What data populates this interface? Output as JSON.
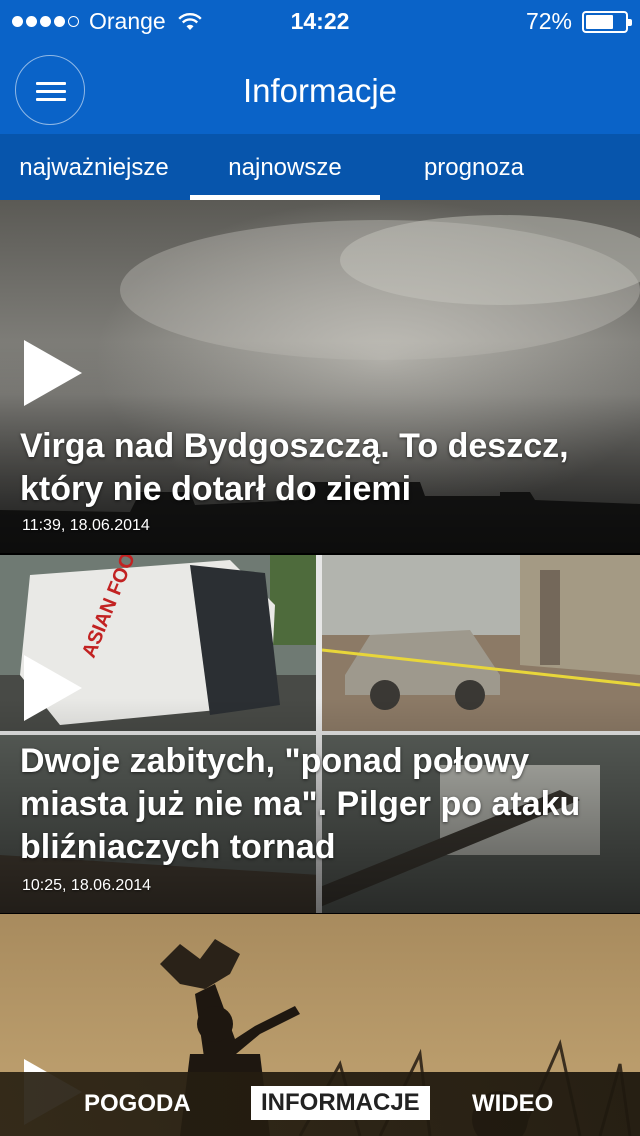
{
  "status_bar": {
    "carrier": "Orange",
    "time": "14:22",
    "battery": "72%",
    "battery_level": 0.72,
    "signal_bars": 4,
    "signal_max": 5
  },
  "header": {
    "title": "Informacje",
    "color": "#0a63c8"
  },
  "tabs": [
    {
      "label": "najważniejsze",
      "active": false
    },
    {
      "label": "najnowsze",
      "active": true
    },
    {
      "label": "prognoza",
      "active": false
    }
  ],
  "feed": [
    {
      "headline": "Virga nad Bydgoszczą. To deszcz, który nie dotarł do ziemi",
      "timestamp": "11:39, 18.06.2014",
      "media": "video"
    },
    {
      "headline": "Dwoje zabitych, \"ponad połowy miasta już nie ma\". Pilger po ataku bliźniaczych tornad",
      "timestamp": "10:25, 18.06.2014",
      "media": "video",
      "image_text": "ASIAN FOODS"
    },
    {
      "media": "video"
    }
  ],
  "bottom_nav": [
    {
      "label": "POGODA",
      "active": false
    },
    {
      "label": "INFORMACJE",
      "active": true
    },
    {
      "label": "WIDEO",
      "active": false
    }
  ]
}
